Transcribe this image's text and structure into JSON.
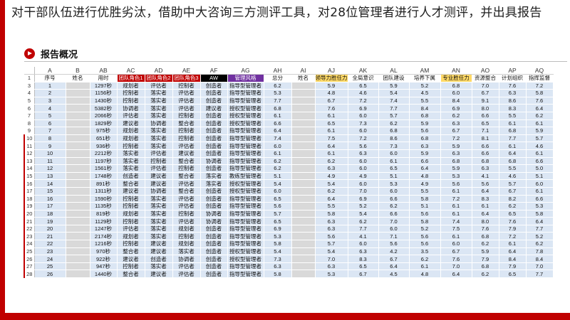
{
  "headline": "对干部队伍进行优胜劣汰，借助中大咨询三方测评工具，对28位管理者进行人才测评，并出具报告",
  "section_title": "报告概况",
  "colors": {
    "accent": "#c00000",
    "cell": "#dbe6f4",
    "blank": "#d9d9d9",
    "purple": "#7030a0",
    "yellow": "#ffd966"
  },
  "col_letters": [
    "",
    "A",
    "B",
    "AB",
    "AC",
    "AD",
    "AE",
    "AF",
    "AG",
    "AH",
    "AI",
    "AJ",
    "AK",
    "AL",
    "AM",
    "AN",
    "AO",
    "AP",
    "AQ"
  ],
  "headers": [
    "1",
    "序号",
    "姓名",
    "用时",
    "团队角色1",
    "团队角色2",
    "团队角色3",
    "AW",
    "管理风格",
    "总分",
    "姓名",
    "领导力胜任力",
    "全局意识",
    "团队建设",
    "培养下属",
    "专业胜任力",
    "资源整合",
    "计划组织",
    "指挥监督"
  ],
  "rows": [
    {
      "r": "3",
      "n": "1",
      "t": "1297秒",
      "r1": "规划者",
      "r2": "评估者",
      "r3": "控制者",
      "aw": "创造者",
      "style": "指导型管理者",
      "total": "6.2",
      "s": [
        "5.9",
        "6.5",
        "5.9",
        "5.2",
        "6.8",
        "7.0",
        "7.6",
        "7.2"
      ]
    },
    {
      "r": "4",
      "n": "2",
      "t": "1156秒",
      "r1": "控制者",
      "r2": "落实者",
      "r3": "评估者",
      "aw": "创造者",
      "style": "指导型管理者",
      "total": "5.3",
      "s": [
        "4.8",
        "4.6",
        "5.4",
        "4.5",
        "6.0",
        "6.7",
        "6.3",
        "5.8"
      ]
    },
    {
      "r": "5",
      "n": "3",
      "t": "1430秒",
      "r1": "控制者",
      "r2": "落实者",
      "r3": "评估者",
      "aw": "创造者",
      "style": "指导型管理者",
      "total": "7.7",
      "s": [
        "6.7",
        "7.2",
        "7.4",
        "5.5",
        "8.4",
        "9.1",
        "8.6",
        "7.6"
      ]
    },
    {
      "r": "6",
      "n": "4",
      "t": "5382秒",
      "r1": "协调者",
      "r2": "落实者",
      "r3": "评估者",
      "aw": "建议者",
      "style": "授权型管理者",
      "total": "6.8",
      "s": [
        "7.6",
        "6.9",
        "7.7",
        "8.4",
        "6.9",
        "8.0",
        "8.3",
        "6.4"
      ]
    },
    {
      "r": "7",
      "n": "5",
      "t": "2066秒",
      "r1": "评估者",
      "r2": "落实者",
      "r3": "控制者",
      "aw": "创造者",
      "style": "授权型管理者",
      "total": "6.1",
      "s": [
        "6.1",
        "6.0",
        "5.7",
        "6.8",
        "6.2",
        "6.6",
        "5.5",
        "6.2"
      ]
    },
    {
      "r": "8",
      "n": "6",
      "t": "1829秒",
      "r1": "建议者",
      "r2": "协调者",
      "r3": "整合者",
      "aw": "创造者",
      "style": "授权型管理者",
      "total": "6.6",
      "s": [
        "6.5",
        "7.3",
        "6.2",
        "5.9",
        "6.3",
        "6.5",
        "6.1",
        "6.1"
      ]
    },
    {
      "r": "9",
      "n": "7",
      "t": "975秒",
      "r1": "规划者",
      "r2": "落实者",
      "r3": "控制者",
      "aw": "创造者",
      "style": "指导型管理者",
      "total": "6.4",
      "s": [
        "6.1",
        "6.0",
        "6.8",
        "5.6",
        "6.7",
        "7.1",
        "6.8",
        "5.9"
      ]
    },
    {
      "r": "10",
      "n": "8",
      "t": "651秒",
      "r1": "规划者",
      "r2": "落实者",
      "r3": "控制者",
      "aw": "创造者",
      "style": "指导型管理者",
      "total": "7.4",
      "s": [
        "7.5",
        "7.2",
        "8.6",
        "6.8",
        "7.2",
        "8.1",
        "7.7",
        "5.7"
      ]
    },
    {
      "r": "11",
      "n": "9",
      "t": "936秒",
      "r1": "控制者",
      "r2": "落实者",
      "r3": "评估者",
      "aw": "创造者",
      "style": "指导型管理者",
      "total": "6.0",
      "s": [
        "6.4",
        "5.6",
        "7.3",
        "6.3",
        "5.9",
        "6.6",
        "6.1",
        "4.6"
      ]
    },
    {
      "r": "12",
      "n": "10",
      "t": "2212秒",
      "r1": "落实者",
      "r2": "评估者",
      "r3": "建议者",
      "aw": "创造者",
      "style": "指导型管理者",
      "total": "6.1",
      "s": [
        "6.1",
        "6.3",
        "6.0",
        "5.9",
        "6.3",
        "6.6",
        "6.4",
        "6.1"
      ]
    },
    {
      "r": "13",
      "n": "11",
      "t": "1197秒",
      "r1": "落实者",
      "r2": "控制者",
      "r3": "整合者",
      "aw": "协调者",
      "style": "指导型管理者",
      "total": "6.2",
      "s": [
        "6.2",
        "6.0",
        "6.1",
        "6.6",
        "6.8",
        "6.8",
        "6.8",
        "6.6"
      ]
    },
    {
      "r": "14",
      "n": "12",
      "t": "1561秒",
      "r1": "落实者",
      "r2": "评估者",
      "r3": "控制者",
      "aw": "创造者",
      "style": "指导型管理者",
      "total": "6.2",
      "s": [
        "6.3",
        "6.0",
        "6.5",
        "6.4",
        "5.9",
        "6.3",
        "5.5",
        "5.0"
      ]
    },
    {
      "r": "15",
      "n": "13",
      "t": "1748秒",
      "r1": "创造者",
      "r2": "建议者",
      "r3": "整合者",
      "aw": "落实者",
      "style": "教练型管理者",
      "total": "5.1",
      "s": [
        "4.9",
        "4.9",
        "5.1",
        "4.8",
        "5.3",
        "4.1",
        "4.6",
        "5.1"
      ]
    },
    {
      "r": "16",
      "n": "14",
      "t": "891秒",
      "r1": "整合者",
      "r2": "建议者",
      "r3": "评估者",
      "aw": "落实者",
      "style": "授权型管理者",
      "total": "5.4",
      "s": [
        "5.4",
        "6.0",
        "5.3",
        "4.9",
        "5.6",
        "5.6",
        "5.7",
        "6.0"
      ]
    },
    {
      "r": "17",
      "n": "15",
      "t": "1311秒",
      "r1": "建议者",
      "r2": "协调者",
      "r3": "整合者",
      "aw": "创造者",
      "style": "授权型管理者",
      "total": "6.0",
      "s": [
        "6.2",
        "7.0",
        "6.0",
        "5.5",
        "6.1",
        "6.4",
        "6.7",
        "6.1"
      ]
    },
    {
      "r": "18",
      "n": "16",
      "t": "1590秒",
      "r1": "控制者",
      "r2": "落实者",
      "r3": "评估者",
      "aw": "创造者",
      "style": "指导型管理者",
      "total": "6.5",
      "s": [
        "6.4",
        "6.9",
        "6.6",
        "5.8",
        "7.2",
        "8.3",
        "8.2",
        "6.6"
      ]
    },
    {
      "r": "19",
      "n": "17",
      "t": "1135秒",
      "r1": "控制者",
      "r2": "落实者",
      "r3": "评估者",
      "aw": "创造者",
      "style": "指导型管理者",
      "total": "5.6",
      "s": [
        "5.5",
        "5.2",
        "6.2",
        "5.1",
        "6.1",
        "6.1",
        "6.2",
        "5.3"
      ]
    },
    {
      "r": "20",
      "n": "18",
      "t": "819秒",
      "r1": "规划者",
      "r2": "落实者",
      "r3": "控制者",
      "aw": "协调者",
      "style": "指导型管理者",
      "total": "5.7",
      "s": [
        "5.8",
        "5.4",
        "6.6",
        "5.6",
        "6.1",
        "6.4",
        "6.5",
        "5.8"
      ]
    },
    {
      "r": "21",
      "n": "19",
      "t": "1129秒",
      "r1": "控制者",
      "r2": "落实者",
      "r3": "评估者",
      "aw": "协调者",
      "style": "指导型管理者",
      "total": "6.5",
      "s": [
        "6.3",
        "6.2",
        "7.0",
        "5.8",
        "7.4",
        "8.0",
        "7.6",
        "6.4"
      ]
    },
    {
      "r": "22",
      "n": "20",
      "t": "1247秒",
      "r1": "评估者",
      "r2": "落实者",
      "r3": "规划者",
      "aw": "创造者",
      "style": "指导型管理者",
      "total": "6.9",
      "s": [
        "6.3",
        "7.7",
        "6.0",
        "5.2",
        "7.5",
        "7.6",
        "7.9",
        "7.7"
      ]
    },
    {
      "r": "23",
      "n": "21",
      "t": "2174秒",
      "r1": "规划者",
      "r2": "落实者",
      "r3": "控制者",
      "aw": "创造者",
      "style": "指导型管理者",
      "total": "5.3",
      "s": [
        "5.6",
        "4.1",
        "7.1",
        "5.6",
        "6.1",
        "6.8",
        "7.2",
        "5.2"
      ]
    },
    {
      "r": "24",
      "n": "22",
      "t": "1216秒",
      "r1": "控制者",
      "r2": "建议者",
      "r3": "规划者",
      "aw": "创造者",
      "style": "指导型管理者",
      "total": "5.8",
      "s": [
        "5.7",
        "6.0",
        "5.6",
        "5.6",
        "6.0",
        "6.2",
        "6.1",
        "6.2"
      ]
    },
    {
      "r": "25",
      "n": "23",
      "t": "970秒",
      "r1": "整合者",
      "r2": "建议者",
      "r3": "落实者",
      "aw": "创造者",
      "style": "授权型管理者",
      "total": "5.4",
      "s": [
        "5.4",
        "6.3",
        "4.2",
        "3.5",
        "6.7",
        "5.9",
        "6.4",
        "7.8"
      ]
    },
    {
      "r": "26",
      "n": "24",
      "t": "922秒",
      "r1": "建议者",
      "r2": "创造者",
      "r3": "协调者",
      "aw": "创造者",
      "style": "授权型管理者",
      "total": "7.3",
      "s": [
        "7.0",
        "8.3",
        "6.7",
        "6.2",
        "7.6",
        "7.9",
        "8.4",
        "8.4"
      ]
    },
    {
      "r": "27",
      "n": "25",
      "t": "947秒",
      "r1": "控制者",
      "r2": "落实者",
      "r3": "评估者",
      "aw": "创造者",
      "style": "指导型管理者",
      "total": "6.3",
      "s": [
        "6.3",
        "6.5",
        "6.4",
        "6.1",
        "7.0",
        "6.8",
        "7.9",
        "7.0"
      ]
    },
    {
      "r": "28",
      "n": "26",
      "t": "1440秒",
      "r1": "整合者",
      "r2": "建议者",
      "r3": "评估者",
      "aw": "创造者",
      "style": "指导型管理者",
      "total": "5.8",
      "s": [
        "5.3",
        "6.7",
        "4.5",
        "4.8",
        "6.4",
        "6.2",
        "6.5",
        "7.7"
      ]
    }
  ]
}
